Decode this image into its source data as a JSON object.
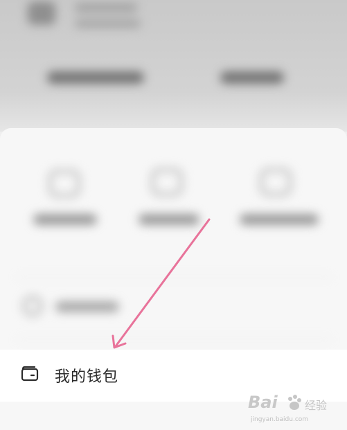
{
  "wallet_row": {
    "label": "我的钱包",
    "icon": "wallet-icon"
  },
  "annotation": {
    "arrow_color": "#e8739a"
  },
  "watermark": {
    "brand": "Bai",
    "extra": "经验",
    "site": "jingyan.baidu.com"
  }
}
